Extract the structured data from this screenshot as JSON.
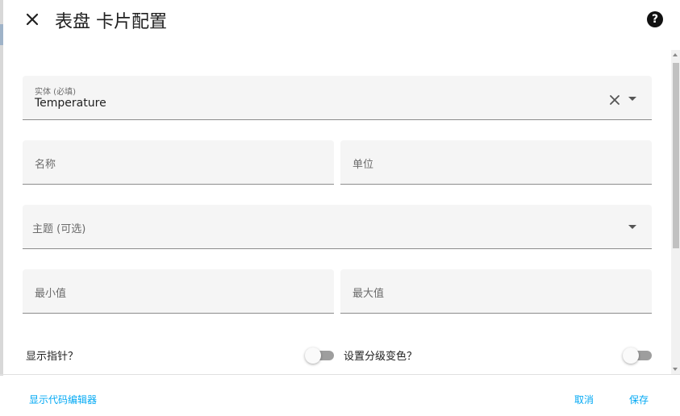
{
  "dialog": {
    "title": "表盘 卡片配置",
    "close_icon": "close-icon",
    "help_icon": "help-circle-icon",
    "help_glyph": "?"
  },
  "form": {
    "entity": {
      "label": "实体 (必填)",
      "value": "Temperature"
    },
    "name": {
      "label": "名称"
    },
    "unit": {
      "label": "单位"
    },
    "theme": {
      "label": "主题 (可选)"
    },
    "min": {
      "label": "最小值"
    },
    "max": {
      "label": "最大值"
    },
    "show_needle": {
      "label": "显示指针？",
      "checked": false
    },
    "severity": {
      "label": "设置分级变色？",
      "checked": false
    }
  },
  "footer": {
    "show_code_editor": "显示代码编辑器",
    "cancel": "取消",
    "save": "保存"
  },
  "colors": {
    "accent": "#03a9f4",
    "field_bg": "#f5f5f5",
    "toggle_off": "#9e9e9e"
  }
}
